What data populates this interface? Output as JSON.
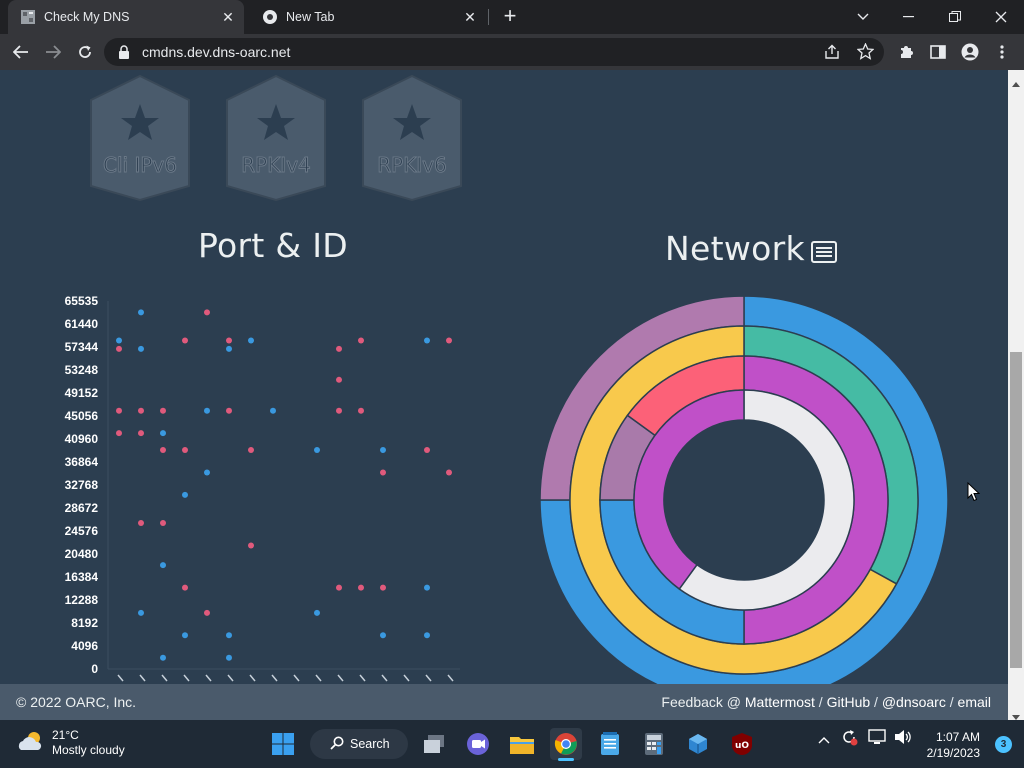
{
  "browser": {
    "tabs": [
      {
        "title": "Check My DNS",
        "active": true
      },
      {
        "title": "New Tab",
        "active": false
      }
    ],
    "url": "cmdns.dev.dns-oarc.net"
  },
  "badges": [
    "Cli IPv6",
    "RPKIv4",
    "RPKIv6"
  ],
  "sections": {
    "port_id_title": "Port & ID",
    "network_title": "Network"
  },
  "chart_data": [
    {
      "type": "scatter",
      "title": "Port & ID",
      "ylim": [
        0,
        65535
      ],
      "y_ticks": [
        "65535",
        "61440",
        "57344",
        "53248",
        "49152",
        "45056",
        "40960",
        "36864",
        "32768",
        "28672",
        "24576",
        "20480",
        "16384",
        "12288",
        "8192",
        "4096",
        "0"
      ],
      "series": [
        {
          "color": "#e05a7c",
          "points": [
            [
              0,
              57000
            ],
            [
              0,
              46000
            ],
            [
              0,
              42000
            ],
            [
              1,
              46000
            ],
            [
              1,
              42000
            ],
            [
              1,
              26000
            ],
            [
              2,
              46000
            ],
            [
              2,
              39000
            ],
            [
              2,
              26000
            ],
            [
              3,
              58500
            ],
            [
              3,
              39000
            ],
            [
              3,
              14500
            ],
            [
              4,
              63500
            ],
            [
              4,
              10000
            ],
            [
              5,
              58500
            ],
            [
              5,
              46000
            ],
            [
              6,
              39000
            ],
            [
              6,
              22000
            ],
            [
              10,
              57000
            ],
            [
              10,
              51500
            ],
            [
              10,
              46000
            ],
            [
              10,
              14500
            ],
            [
              11,
              58500
            ],
            [
              11,
              46000
            ],
            [
              11,
              14500
            ],
            [
              12,
              35000
            ],
            [
              12,
              14500
            ],
            [
              14,
              39000
            ],
            [
              15,
              58500
            ],
            [
              15,
              35000
            ]
          ]
        },
        {
          "color": "#3a99e0",
          "points": [
            [
              0,
              58500
            ],
            [
              1,
              63500
            ],
            [
              1,
              57000
            ],
            [
              1,
              10000
            ],
            [
              2,
              42000
            ],
            [
              2,
              18500
            ],
            [
              2,
              2000
            ],
            [
              3,
              31000
            ],
            [
              3,
              6000
            ],
            [
              4,
              46000
            ],
            [
              4,
              35000
            ],
            [
              5,
              57000
            ],
            [
              5,
              6000
            ],
            [
              5,
              2000
            ],
            [
              6,
              58500
            ],
            [
              7,
              46000
            ],
            [
              9,
              39000
            ],
            [
              9,
              10000
            ],
            [
              12,
              39000
            ],
            [
              12,
              6000
            ],
            [
              14,
              58500
            ],
            [
              14,
              14500
            ],
            [
              14,
              6000
            ]
          ]
        }
      ]
    },
    {
      "type": "pie",
      "title": "Network",
      "rings": [
        [
          {
            "value": 75,
            "color": "#3a99e0"
          },
          {
            "value": 25,
            "color": "#b07aae"
          }
        ],
        [
          {
            "value": 33,
            "color": "#45bba4"
          },
          {
            "value": 67,
            "color": "#f8c94c"
          }
        ],
        [
          {
            "value": 50,
            "color": "#c050c8"
          },
          {
            "value": 25,
            "color": "#3a99e0"
          },
          {
            "value": 10,
            "color": "#a97aaa"
          },
          {
            "value": 15,
            "color": "#fc6178"
          }
        ],
        [
          {
            "value": 60,
            "color": "#ebebee"
          },
          {
            "value": 40,
            "color": "#c050c8"
          }
        ]
      ]
    }
  ],
  "footer": {
    "copyright": "© 2022 OARC, Inc.",
    "feedback_prefix": "Feedback @",
    "links": [
      "Mattermost",
      "GitHub",
      "@dnsoarc",
      "email"
    ],
    "separator": "/"
  },
  "taskbar": {
    "temperature": "21°C",
    "weather": "Mostly cloudy",
    "search_label": "Search",
    "time": "1:07 AM",
    "date": "2/19/2023",
    "notification_count": "3"
  },
  "colors": {
    "page_bg": "#2c3e50",
    "footer_bg": "#4a5a6b",
    "pink": "#e05a7c",
    "blue": "#3a99e0"
  }
}
